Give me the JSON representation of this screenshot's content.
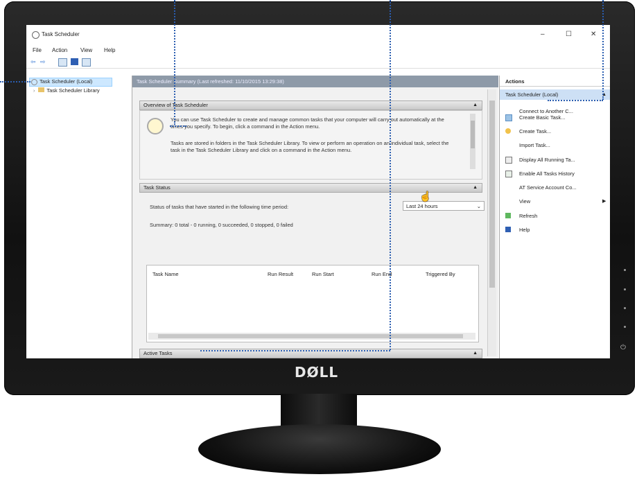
{
  "monitor": {
    "brand": "DØLL"
  },
  "window": {
    "title": "Task Scheduler",
    "controls": {
      "minimize": "–",
      "maximize": "☐",
      "close": "✕"
    }
  },
  "menu": [
    "File",
    "Action",
    "View",
    "Help"
  ],
  "tree": {
    "root": "Task Scheduler (Local)",
    "child": "Task Scheduler Library"
  },
  "middle": {
    "header": "Task Scheduler Summary (Last refreshed: 11/10/2015 13:29:38)",
    "overview": {
      "title": "Overview of Task Scheduler",
      "para1": "You can use Task Scheduler to create and manage common tasks that your computer will carry out automatically at the times you specify. To begin, click a command in the Action menu.",
      "para2": "Tasks are stored in folders in the Task Scheduler Library. To view or perform an operation on an individual task, select the task in the Task Scheduler Library and click on a command in the Action menu."
    },
    "status": {
      "title": "Task Status",
      "period_label": "Status of tasks that have started in the following time period:",
      "period_value": "Last 24 hours",
      "summary": "Summary: 0 total - 0 running, 0 succeeded, 0 stopped, 0 failed",
      "columns": [
        "Task Name",
        "Run Result",
        "Run Start",
        "Run End",
        "Triggered By"
      ]
    },
    "active": {
      "title": "Active Tasks"
    }
  },
  "actions": {
    "header": "Actions",
    "section": "Task Scheduler (Local)",
    "items": [
      "Connect to Another C...",
      "Create Basic Task...",
      "Create Task...",
      "Import Task...",
      "Display All Running Ta...",
      "Enable All Tasks History",
      "AT Service Account Co...",
      "View",
      "Refresh",
      "Help"
    ]
  },
  "colors": {
    "accent": "#2a5db0",
    "selection": "#cde0f5",
    "header": "#8e9aa8"
  }
}
